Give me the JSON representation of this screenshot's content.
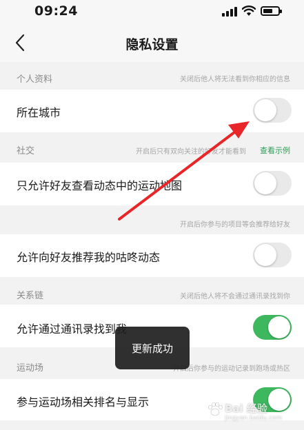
{
  "status_bar": {
    "time": "09:24"
  },
  "nav": {
    "title": "隐私设置"
  },
  "sections": {
    "personal": {
      "title": "个人资料",
      "hint": "关闭后他人将无法看到你相应的信息",
      "rows": [
        {
          "label": "所在城市",
          "on": false
        }
      ]
    },
    "social": {
      "title": "社交",
      "hint": "开启后只有双向关注的好友才能看到",
      "link": "查看示例",
      "rows": [
        {
          "label": "只允许好友查看动态中的运动地图",
          "on": false
        }
      ],
      "hint2": "开启后你参与的项目等会推荐给好友",
      "rows2": [
        {
          "label": "允许向好友推荐我的咕咚动态",
          "on": false
        }
      ]
    },
    "relations": {
      "title": "关系链",
      "hint": "关闭后他人将不会通过通讯录找到你",
      "rows": [
        {
          "label": "允许通过通讯录找到我",
          "on": true
        }
      ]
    },
    "sports": {
      "title": "运动场",
      "hint": "开启后你参与的运动记录到跑场或热区",
      "rows": [
        {
          "label": "参与运动场相关排名与显示",
          "on": true
        }
      ]
    }
  },
  "toast": {
    "text": "更新成功"
  },
  "watermark": {
    "text": "Bai 经验",
    "sub": "jingyan.baidu.com"
  },
  "colors": {
    "toggle_on": "#3eb85f",
    "toggle_off": "#e9e9e9",
    "link": "#2e9b56",
    "annotation": "#e8262a"
  }
}
